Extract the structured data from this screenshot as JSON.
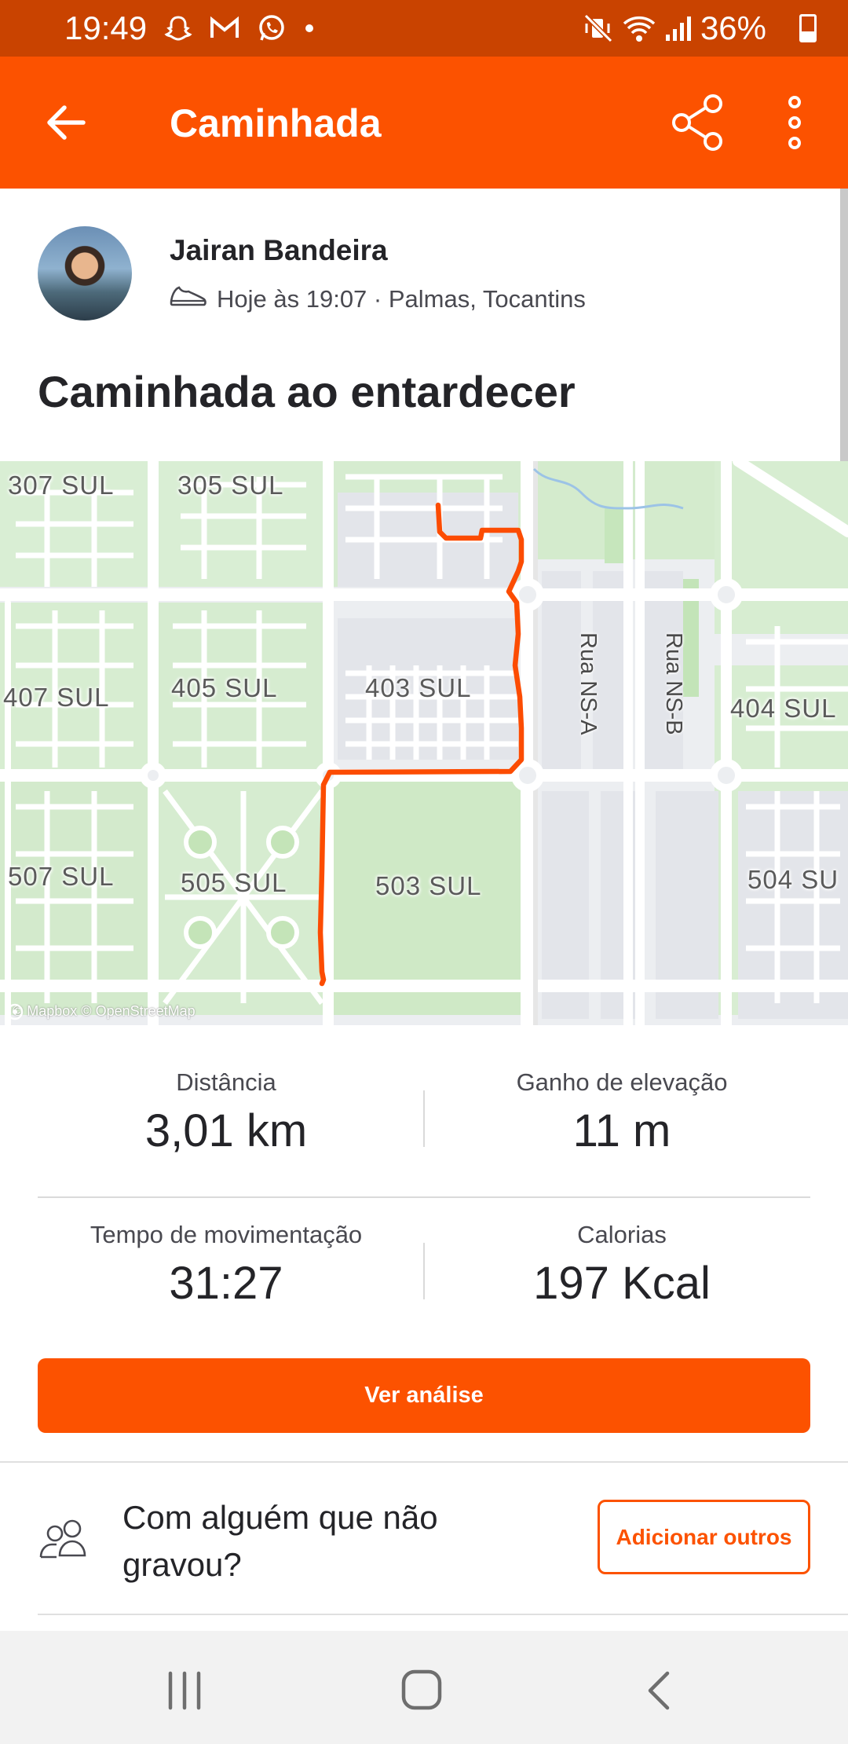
{
  "status_bar": {
    "time": "19:49",
    "battery": "36%",
    "notification_icons": [
      "snapchat-icon",
      "gmail-icon",
      "whatsapp-icon",
      "dot-icon"
    ],
    "system_icons": [
      "mute-vibrate-icon",
      "wifi-icon",
      "signal-icon",
      "battery-icon"
    ],
    "battery_level": 0.36
  },
  "app_bar": {
    "title": "Caminhada",
    "back_icon": "arrow-left-icon",
    "share_icon": "share-icon",
    "more_icon": "more-vertical-icon"
  },
  "author": {
    "name": "Jairan Bandeira",
    "meta": "Hoje às 19:07 · Palmas, Tocantins",
    "sport_icon": "shoe-icon"
  },
  "activity": {
    "title": "Caminhada ao entardecer"
  },
  "map": {
    "labels": [
      "307 SUL",
      "305 SUL",
      "407 SUL",
      "405 SUL",
      "403 SUL",
      "404 SUL",
      "507 SUL",
      "505 SUL",
      "503 SUL",
      "504 SU"
    ],
    "road_labels": [
      "Rua NS-A",
      "Rua NS-B"
    ],
    "attribution": "© Mapbox © OpenStreetMap",
    "colors": {
      "route": "#fc4c02",
      "park": "#c8e6c0",
      "road": "#ffffff",
      "background": "#eef0f2"
    }
  },
  "stats": {
    "distance": {
      "label": "Distância",
      "value": "3,01 km"
    },
    "elevation": {
      "label": "Ganho de elevação",
      "value": "11 m"
    },
    "moving_time": {
      "label": "Tempo de movimentação",
      "value": "31:27"
    },
    "calories": {
      "label": "Calorias",
      "value": "197 Kcal"
    }
  },
  "analysis_button": {
    "label": "Ver análise"
  },
  "others": {
    "text": "Com alguém que não gravou?",
    "button": "Adicionar outros",
    "icon": "people-icon"
  },
  "nav_bar": {
    "icons": [
      "recent-apps-icon",
      "home-icon",
      "back-icon"
    ]
  },
  "theme": {
    "accent": "#fc5200",
    "status_bar": "#c94300"
  }
}
